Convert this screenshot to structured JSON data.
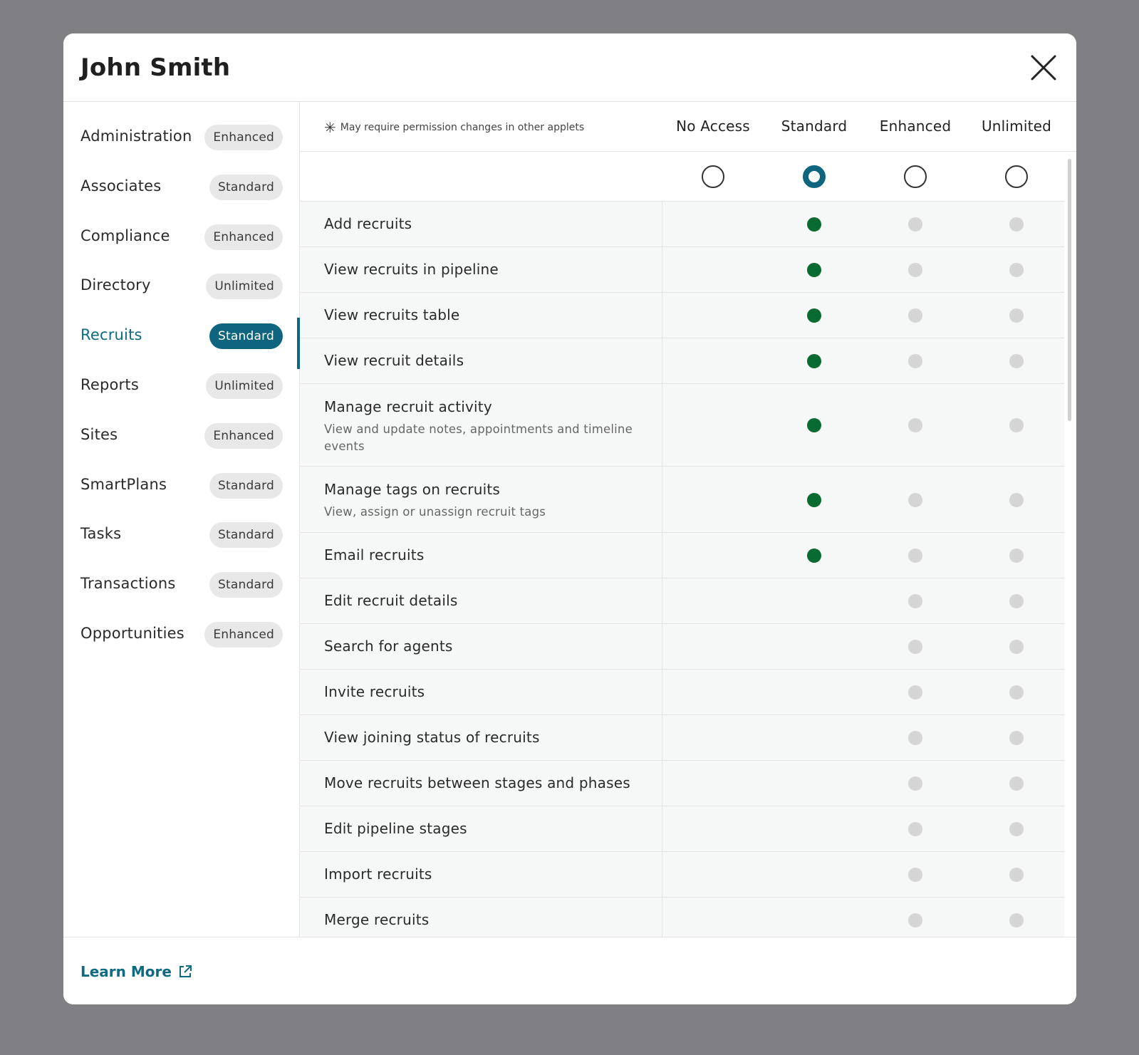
{
  "modal": {
    "title": "John Smith",
    "close_icon": "close-icon"
  },
  "sidebar": {
    "items": [
      {
        "label": "Administration",
        "badge": "Enhanced"
      },
      {
        "label": "Associates",
        "badge": "Standard"
      },
      {
        "label": "Compliance",
        "badge": "Enhanced"
      },
      {
        "label": "Directory",
        "badge": "Unlimited"
      },
      {
        "label": "Recruits",
        "badge": "Standard",
        "active": true
      },
      {
        "label": "Reports",
        "badge": "Unlimited"
      },
      {
        "label": "Sites",
        "badge": "Enhanced"
      },
      {
        "label": "SmartPlans",
        "badge": "Standard"
      },
      {
        "label": "Tasks",
        "badge": "Standard"
      },
      {
        "label": "Transactions",
        "badge": "Standard"
      },
      {
        "label": "Opportunities",
        "badge": "Enhanced"
      }
    ]
  },
  "permissions": {
    "note": "May require permission changes in other applets",
    "note_icon": "asterisk-icon",
    "columns": [
      "No Access",
      "Standard",
      "Enhanced",
      "Unlimited"
    ],
    "selected_level": "Standard",
    "rows": [
      {
        "title": "Add recruits",
        "desc": "",
        "levels": [
          false,
          true,
          true,
          true
        ],
        "standard_on": true
      },
      {
        "title": "View recruits in pipeline",
        "desc": "",
        "standard_on": true
      },
      {
        "title": "View recruits table",
        "desc": "",
        "standard_on": true
      },
      {
        "title": "View recruit details",
        "desc": "",
        "standard_on": true
      },
      {
        "title": "Manage recruit activity",
        "desc": "View and update notes, appointments and timeline events",
        "standard_on": true
      },
      {
        "title": "Manage tags on recruits",
        "desc": "View, assign or unassign recruit tags",
        "standard_on": true
      },
      {
        "title": "Email recruits",
        "desc": "",
        "standard_on": true
      },
      {
        "title": "Edit recruit details",
        "desc": "",
        "standard_on": false
      },
      {
        "title": "Search for agents",
        "desc": "",
        "standard_on": false
      },
      {
        "title": "Invite recruits",
        "desc": "",
        "standard_on": false
      },
      {
        "title": "View joining status of recruits",
        "desc": "",
        "standard_on": false
      },
      {
        "title": "Move recruits between stages and phases",
        "desc": "",
        "standard_on": false
      },
      {
        "title": "Edit pipeline stages",
        "desc": "",
        "standard_on": false
      },
      {
        "title": "Import recruits",
        "desc": "",
        "standard_on": false
      },
      {
        "title": "Merge recruits",
        "desc": "",
        "standard_on": false
      }
    ]
  },
  "footer": {
    "learn_more": "Learn More",
    "learn_more_icon": "external-link-icon"
  },
  "colors": {
    "accent": "#0f657d",
    "granted": "#0a6b30",
    "inactive": "#d5d5d5"
  }
}
